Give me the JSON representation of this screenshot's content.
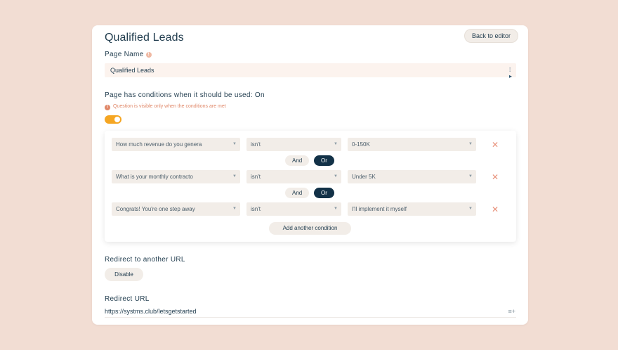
{
  "header": {
    "title": "Qualified Leads",
    "back_label": "Back to editor"
  },
  "page_name": {
    "label": "Page Name",
    "value": "Qualified Leads"
  },
  "conditions": {
    "heading": "Page has conditions when it should be used: On",
    "warning": "Question is visible only when the conditions are met",
    "toggle_on": true,
    "rows": [
      {
        "question": "How much revenue do you genera",
        "operator": "isn't",
        "value": "0-150K"
      },
      {
        "question": "What is your monthly contracto",
        "operator": "isn't",
        "value": "Under 5K"
      },
      {
        "question": "Congrats! You're one step away",
        "operator": "isn't",
        "value": "I'll implement it myself"
      }
    ],
    "and_label": "And",
    "or_label": "Or",
    "add_label": "Add another condition"
  },
  "redirect": {
    "label": "Redirect to another URL",
    "disable_label": "Disable",
    "url_label": "Redirect URL",
    "url_value": "https://systms.club/letsgetstarted"
  },
  "colors": {
    "background": "#f2ddd3",
    "accent_toggle": "#f5a623",
    "dark": "#123147",
    "warning": "#e08768"
  }
}
